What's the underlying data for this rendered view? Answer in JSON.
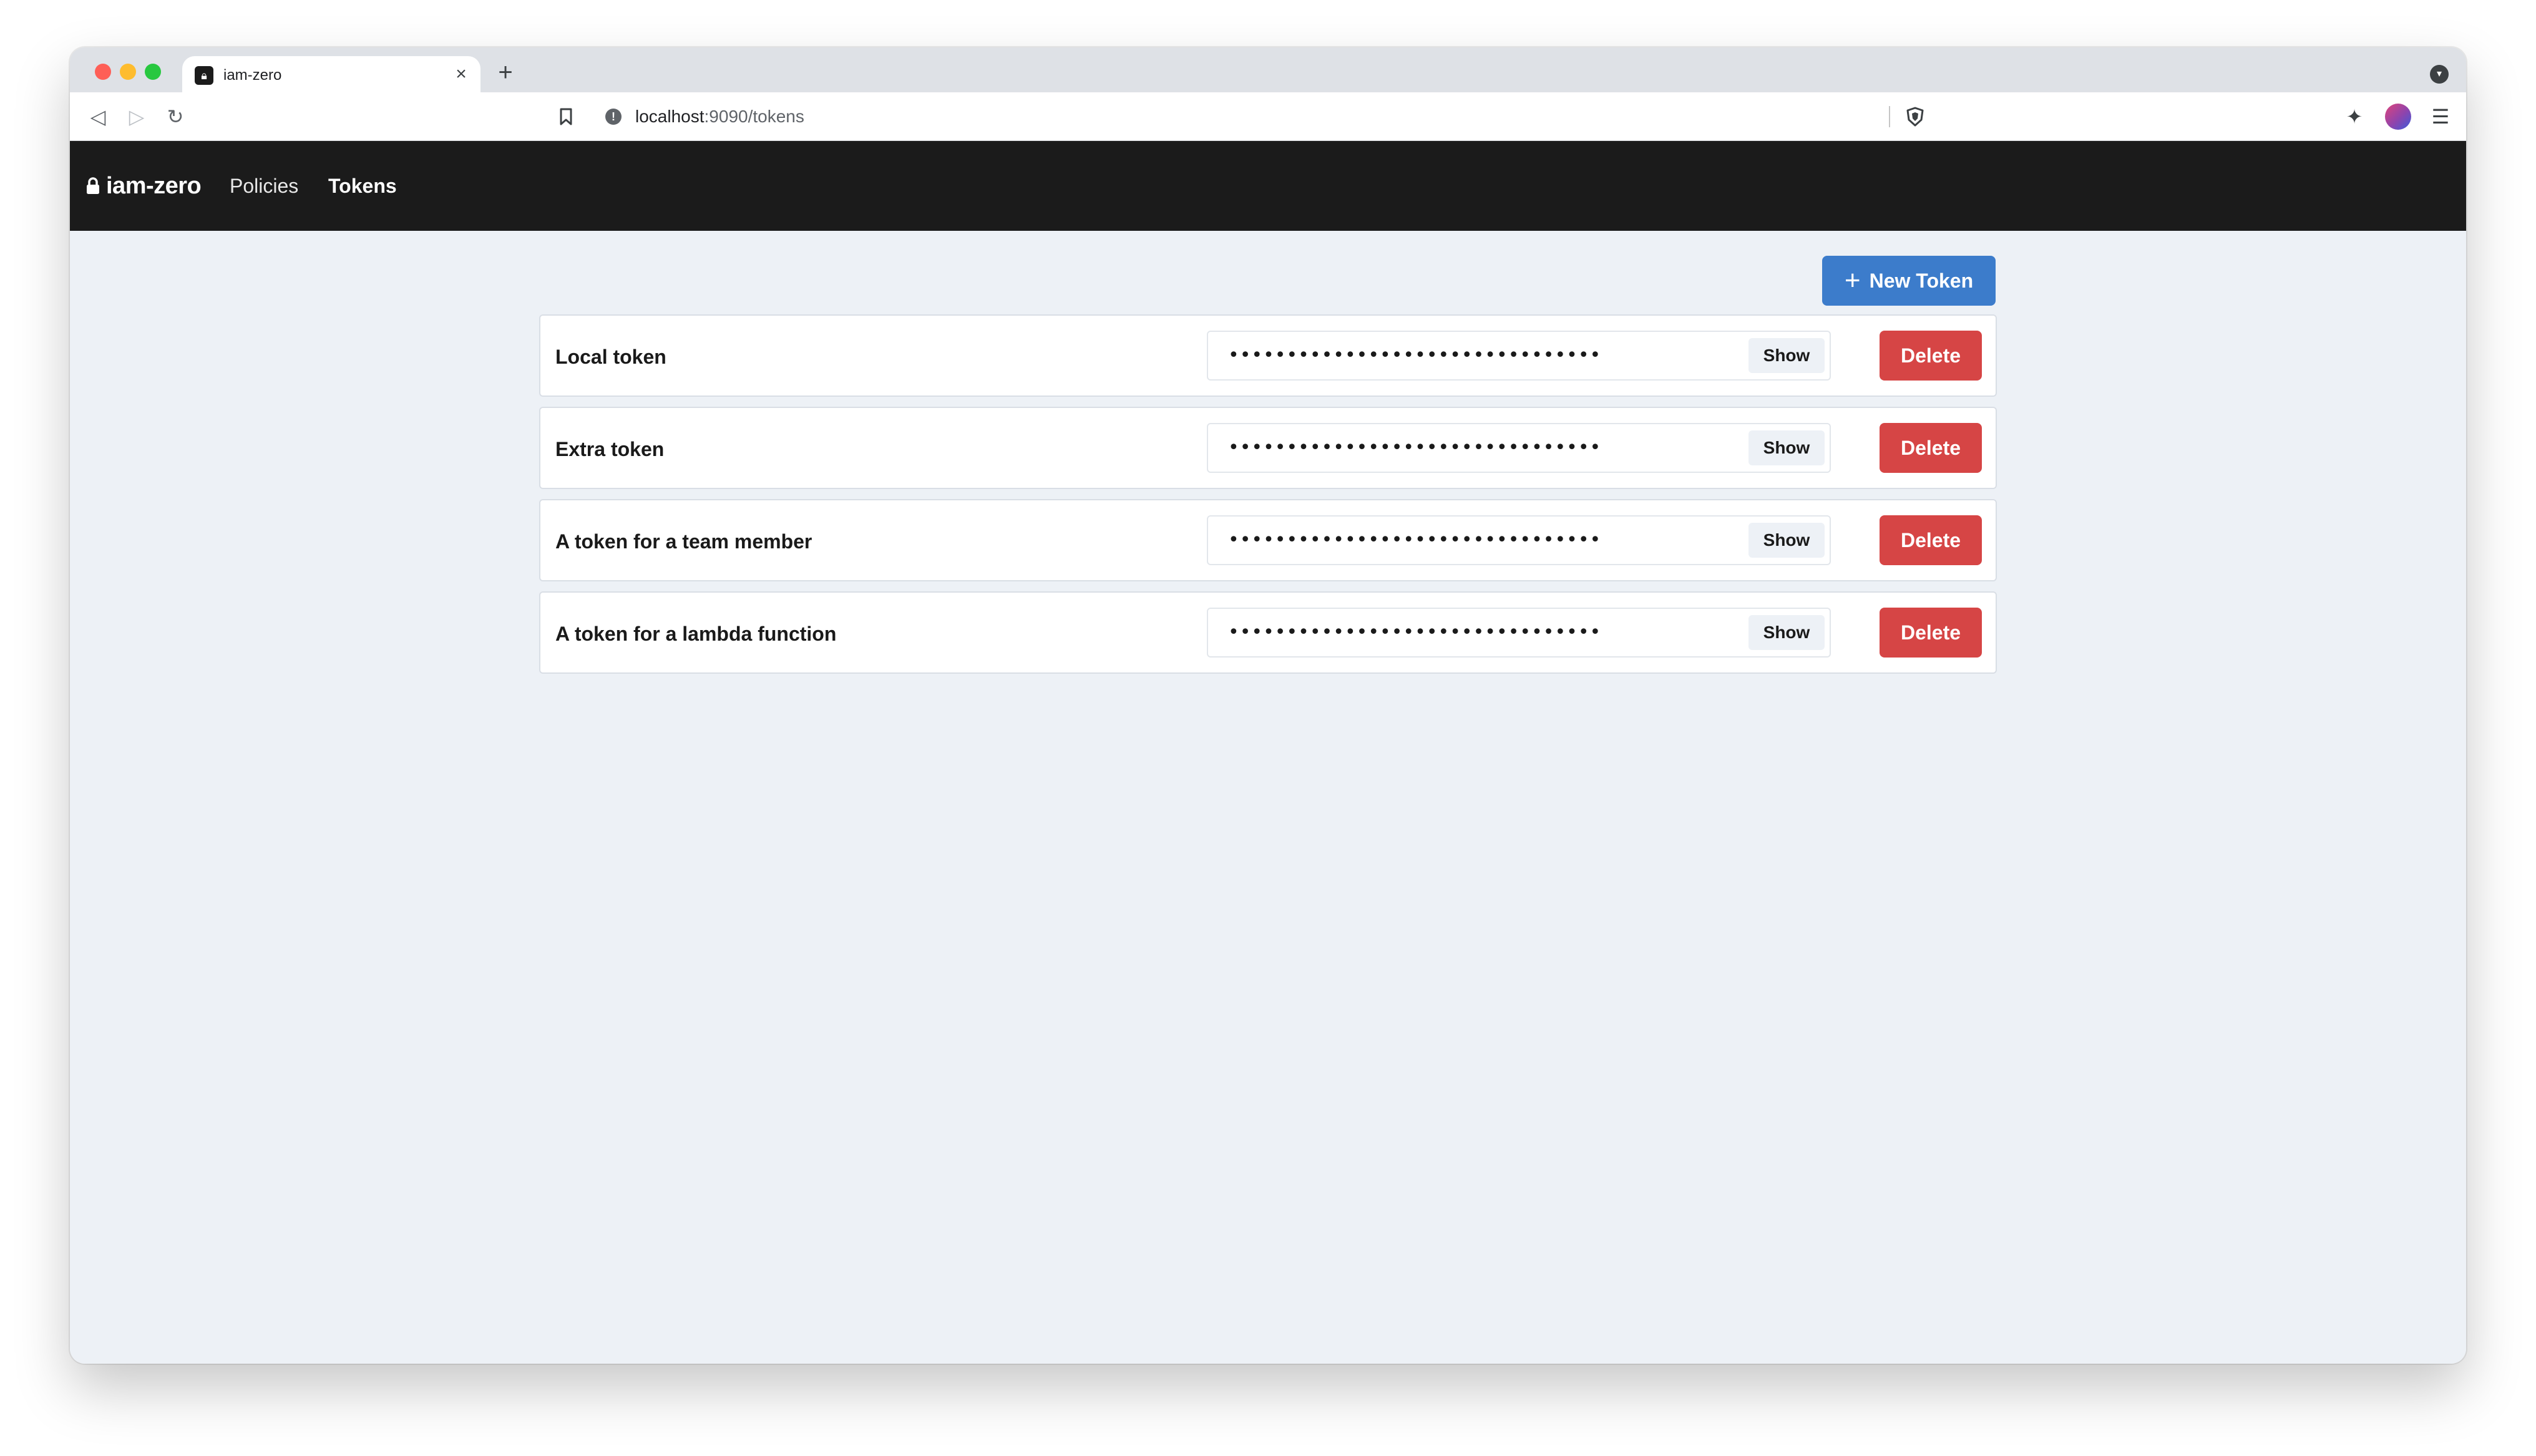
{
  "browser": {
    "tab_title": "iam-zero",
    "tab_close": "×",
    "new_tab": "+",
    "url_host": "localhost",
    "url_path": ":9090/tokens"
  },
  "app": {
    "brand": "iam-zero",
    "nav": [
      {
        "label": "Policies",
        "active": false
      },
      {
        "label": "Tokens",
        "active": true
      }
    ]
  },
  "actions": {
    "new_token_label": "New Token",
    "show_label": "Show",
    "delete_label": "Delete",
    "masked_value": "••••••••••••••••••••••••••••••••"
  },
  "tokens": [
    {
      "name": "Local token"
    },
    {
      "name": "Extra token"
    },
    {
      "name": "A token for a team member"
    },
    {
      "name": "A token for a lambda function"
    }
  ],
  "colors": {
    "navbar": "#1b1b1b",
    "primary": "#3c7ccb",
    "danger": "#d64545",
    "background": "#edf1f6"
  }
}
